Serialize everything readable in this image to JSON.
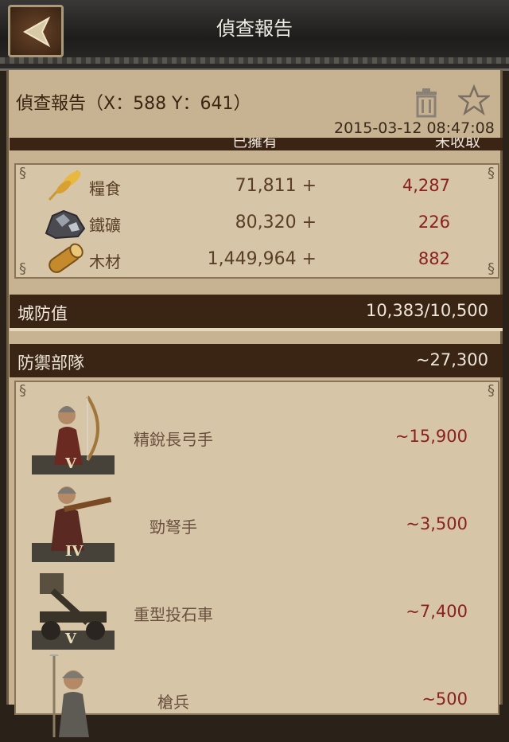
{
  "header": {
    "title": "偵查報告"
  },
  "report": {
    "title": "偵查報告（X：588 Y：641）",
    "date": "2015-03-12 08:47:08",
    "col_owned": "已擁有",
    "col_uncollected": "未收取"
  },
  "resources": [
    {
      "icon": "wheat-icon",
      "name": "糧食",
      "owned": "71,811 +",
      "uncollected": "4,287"
    },
    {
      "icon": "ore-icon",
      "name": "鐵礦",
      "owned": "80,320 +",
      "uncollected": "226"
    },
    {
      "icon": "wood-icon",
      "name": "木材",
      "owned": "1,449,964 +",
      "uncollected": "882"
    }
  ],
  "defense": {
    "label": "城防值",
    "value": "10,383/10,500"
  },
  "troops_header": {
    "label": "防禦部隊",
    "value": "~27,300"
  },
  "troops": [
    {
      "name": "精銳長弓手",
      "count": "~15,900",
      "rank": "V"
    },
    {
      "name": "勁弩手",
      "count": "~3,500",
      "rank": "IV"
    },
    {
      "name": "重型投石車",
      "count": "~7,400",
      "rank": "V"
    },
    {
      "name": "槍兵",
      "count": "~500",
      "rank": ""
    }
  ],
  "colors": {
    "panel": "#c7b291",
    "dark_bar": "#3a2414",
    "red_value": "#8a2020"
  }
}
